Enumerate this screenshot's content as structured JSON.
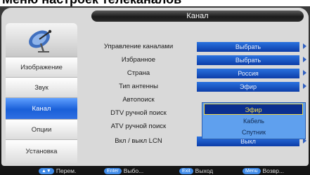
{
  "page_heading": "Меню настроек телеканалов",
  "title": "Канал",
  "sidebar": {
    "items": [
      {
        "label": "Изображение",
        "active": false
      },
      {
        "label": "Звук",
        "active": false
      },
      {
        "label": "Канал",
        "active": true
      },
      {
        "label": "Опции",
        "active": false
      },
      {
        "label": "Установка",
        "active": false
      }
    ]
  },
  "menu": {
    "rows": [
      {
        "label": "Управление каналами",
        "value": "Выбрать"
      },
      {
        "label": "Избранное",
        "value": "Выбрать"
      },
      {
        "label": "Страна",
        "value": "Россия"
      },
      {
        "label": "Тип антенны",
        "value": "Эфир"
      },
      {
        "label": "Автопоиск",
        "value": ""
      },
      {
        "label": "DTV ручной поиск",
        "value": ""
      },
      {
        "label": "ATV ручной поиск",
        "value": ""
      },
      {
        "label": "Вкл / выкл LCN",
        "value": "Выкл"
      }
    ]
  },
  "dropdown": {
    "options": [
      "Эфир",
      "Кабель",
      "Спутник"
    ],
    "selected": "Эфир"
  },
  "hints": [
    {
      "key": "▲▼",
      "label": "Перем."
    },
    {
      "key": "Enter",
      "label": "Выбо..."
    },
    {
      "key": "Exit",
      "label": "Выход"
    },
    {
      "key": "Menu",
      "label": "Возвр..."
    }
  ],
  "colors": {
    "accent": "#1a5fd8",
    "value_bg": "#0c3da8",
    "dropdown_bg": "#5fa0ee",
    "selected_text": "#f7e14a"
  },
  "icons": {
    "logo": "satellite-dish-icon",
    "row_arrow": "arrow-right-icon"
  }
}
